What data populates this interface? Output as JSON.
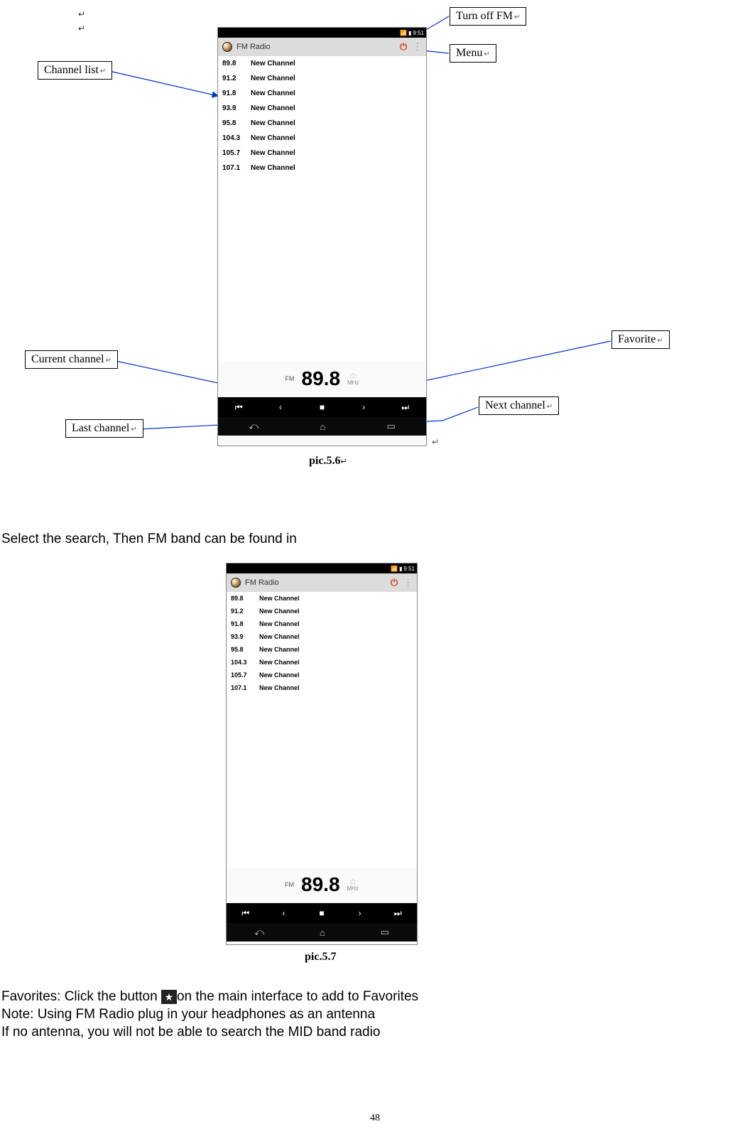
{
  "para_mark": "↵",
  "callouts": {
    "turn_off_fm": "Turn off FM",
    "menu": "Menu",
    "channel_list": "Channel list",
    "favorite": "Favorite",
    "current_channel": "Current channel",
    "next_channel": "Next channel",
    "last_channel": "Last channel"
  },
  "phone": {
    "status": {
      "time": "9:51"
    },
    "app_title": "FM Radio",
    "channels": [
      {
        "freq": "89.8",
        "name": "New Channel"
      },
      {
        "freq": "91.2",
        "name": "New Channel"
      },
      {
        "freq": "91.8",
        "name": "New Channel"
      },
      {
        "freq": "93.9",
        "name": "New Channel"
      },
      {
        "freq": "95.8",
        "name": "New Channel"
      },
      {
        "freq": "104.3",
        "name": "New Channel"
      },
      {
        "freq": "105.7",
        "name": "New Channel"
      },
      {
        "freq": "107.1",
        "name": "New Channel"
      }
    ],
    "fm_label": "FM",
    "current_freq": "89.8",
    "mhz": "MHz"
  },
  "captions": {
    "pic56": "pic.5.6",
    "pic57": "pic.5.7"
  },
  "text": {
    "select_search": "Select the search, Then FM band can be found in",
    "favorites_a": "Favorites: Click the button ",
    "favorites_b": "on the main interface to add to Favorites",
    "note": "Note: Using FM Radio plug in your headphones as an antenna",
    "no_antenna": "If no antenna, you will not be able to search the MID band radio"
  },
  "page_number": "48"
}
